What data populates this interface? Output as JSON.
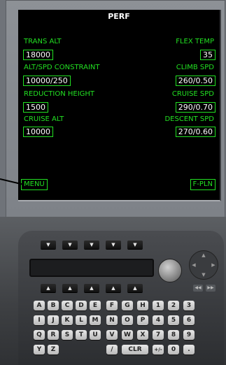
{
  "screen": {
    "title": "PERF",
    "left": {
      "trans_alt_label": "TRANS ALT",
      "trans_alt_value": "18000",
      "alt_spd_label": "ALT/SPD CONSTRAINT",
      "alt_spd_value": "10000/250",
      "reduction_label": "REDUCTION HEIGHT",
      "reduction_value": "1500",
      "cruise_alt_label": "CRUISE ALT",
      "cruise_alt_value": "10000",
      "menu_label": "MENU"
    },
    "right": {
      "flex_temp_label": "FLEX TEMP",
      "flex_temp_value": "35",
      "climb_spd_label": "CLIMB SPD",
      "climb_spd_value": "260/0.50",
      "cruise_spd_label": "CRUISE SPD",
      "cruise_spd_value": "290/0.70",
      "descent_spd_label": "DESCENT SPD",
      "descent_spd_value": "270/0.60",
      "fpln_label": "F-PLN"
    }
  },
  "keypad": {
    "top_arrow_keys": [
      "▼",
      "▼",
      "▼",
      "▼",
      "▼"
    ],
    "bottom_arrow_keys": [
      "▲",
      "▲",
      "▲",
      "▲",
      "▲"
    ],
    "nav_keys": [
      "◀◀",
      "▶▶"
    ],
    "rows": [
      [
        "A",
        "B",
        "C",
        "D",
        "E",
        "F",
        "G",
        "H",
        "1",
        "2",
        "3"
      ],
      [
        "I",
        "J",
        "K",
        "L",
        "M",
        "N",
        "O",
        "P",
        "4",
        "5",
        "6"
      ],
      [
        "Q",
        "R",
        "S",
        "T",
        "U",
        "V",
        "W",
        "X",
        "7",
        "8",
        "9"
      ]
    ],
    "last_row": {
      "y": "Y",
      "z": "Z",
      "slash": "/",
      "clr": "CLR",
      "plusminus": "+/-",
      "zero": "0",
      "dot": "."
    }
  },
  "colors": {
    "screen_green": "#22e022",
    "screen_white": "#ffffff"
  }
}
